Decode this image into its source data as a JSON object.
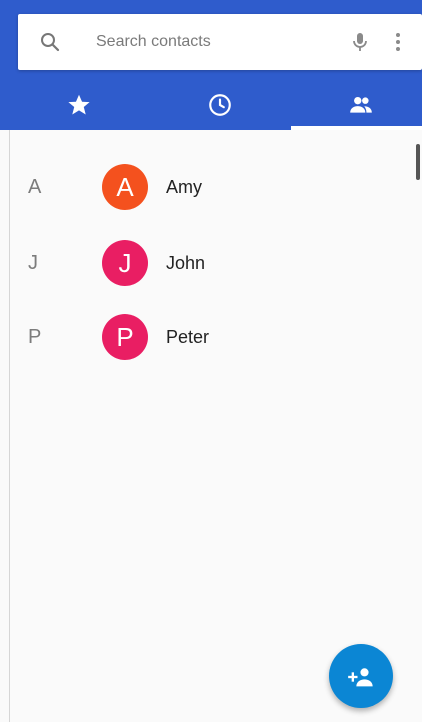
{
  "search": {
    "placeholder": "Search contacts"
  },
  "tabs": [
    {
      "name": "favorites",
      "icon": "star-icon",
      "selected": false
    },
    {
      "name": "recents",
      "icon": "clock-icon",
      "selected": false
    },
    {
      "name": "contacts",
      "icon": "people-icon",
      "selected": true
    }
  ],
  "contacts": [
    {
      "section": "A",
      "initial": "A",
      "name": "Amy",
      "avatar_color": "#f4511e"
    },
    {
      "section": "J",
      "initial": "J",
      "name": "John",
      "avatar_color": "#e91e63"
    },
    {
      "section": "P",
      "initial": "P",
      "name": "Peter",
      "avatar_color": "#e91e63"
    }
  ],
  "fab": {
    "icon": "add-person-icon"
  },
  "colors": {
    "header": "#2f5ccc",
    "fab": "#0b86d4"
  }
}
